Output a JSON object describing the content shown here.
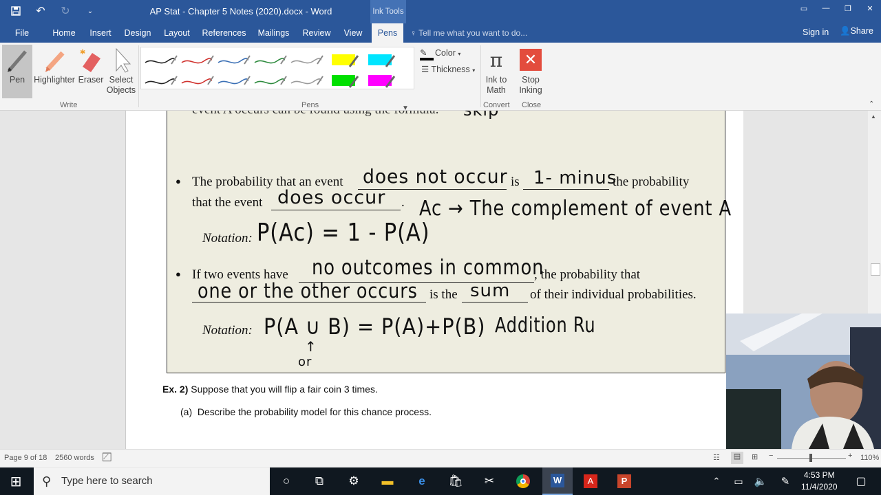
{
  "window": {
    "title": "AP Stat - Chapter 5 Notes (2020).docx - Word",
    "context_tab_group": "Ink Tools"
  },
  "tabs": [
    "File",
    "Home",
    "Insert",
    "Design",
    "Layout",
    "References",
    "Mailings",
    "Review",
    "View",
    "Pens"
  ],
  "active_tab": "Pens",
  "tell_me": "Tell me what you want to do...",
  "sign_in": "Sign in",
  "share": "Share",
  "ribbon": {
    "write": {
      "pen": "Pen",
      "highlighter": "Highlighter",
      "eraser": "Eraser",
      "select": "Select Objects",
      "group": "Write"
    },
    "pens_group": "Pens",
    "color": "Color",
    "thickness": "Thickness",
    "convert": {
      "ink_to_math": "Ink to Math",
      "group": "Convert"
    },
    "close": {
      "stop_inking": "Stop Inking",
      "group": "Close"
    },
    "pen_colors": [
      "#222222",
      "#d0312d",
      "#3a6fb5",
      "#2e8b3e",
      "#9a9a9a",
      "#ffff00",
      "#00e5ff",
      "#222222",
      "#d0312d",
      "#3a6fb5",
      "#2e8b3e",
      "#9a9a9a",
      "#00e000",
      "#ff00ff"
    ]
  },
  "doc": {
    "top_partial": "event A occurs can be found using the formula:",
    "top_ink": "skip",
    "b1": {
      "t1": "The probability that an event",
      "ink1": "does not occur",
      "t2": "is",
      "ink2": "1- minus",
      "t3": "the probability",
      "t4": "that the event",
      "ink3": "does occur",
      "t5": ".",
      "ink4": "Ac → The complement of event A",
      "notation": "Notation:",
      "ink5": "P(Ac) = 1 - P(A)"
    },
    "b2": {
      "t1": "If two events have",
      "ink1": "no outcomes in common",
      "t2": ", the probability that",
      "ink2": "one or the other occurs",
      "t3": "is the",
      "ink3": "sum",
      "t4": "of their individual probabilities.",
      "notation": "Notation:",
      "ink4": "P(A ∪ B) = P(A)+P(B)",
      "ink5": "Addition Ru",
      "ink6": "↑",
      "ink7": "or"
    },
    "ex_label": "Ex. 2)",
    "ex_text": "Suppose that you will flip a fair coin 3 times.",
    "ex_a_label": "(a)",
    "ex_a_text": "Describe the probability model for this chance process."
  },
  "status": {
    "page": "Page 9 of 18",
    "words": "2560 words",
    "zoom": "110%"
  },
  "taskbar": {
    "search": "Type here to search",
    "time": "4:53 PM",
    "date": "11/4/2020"
  }
}
